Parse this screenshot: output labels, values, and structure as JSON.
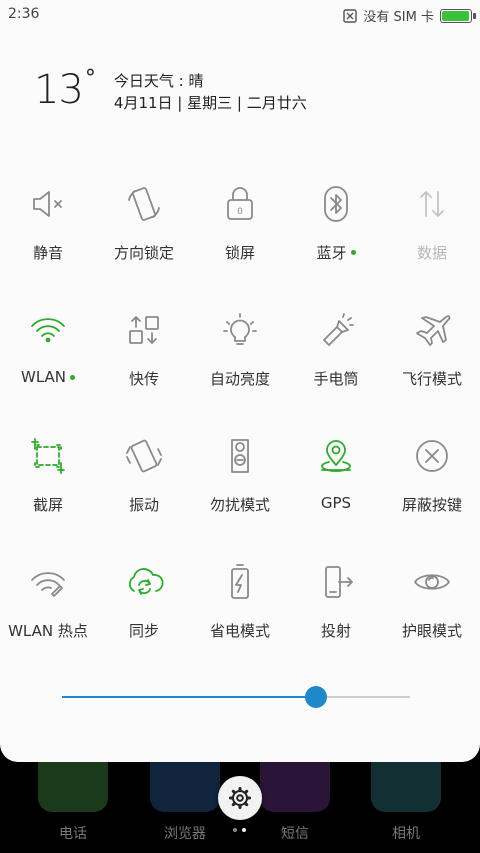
{
  "status": {
    "time": "2:36",
    "sim": "没有 SIM 卡",
    "battery_level": 0.95,
    "battery_color": "#3ec13a"
  },
  "weather": {
    "temp": "13",
    "degree": "°",
    "line1": "今日天气 : 晴",
    "line2": "4月11日 | 星期三 | 二月廿六"
  },
  "toggles": [
    {
      "label": "静音",
      "icon": "mute-icon",
      "active": false
    },
    {
      "label": "方向锁定",
      "icon": "rotation-lock-icon",
      "active": false
    },
    {
      "label": "锁屏",
      "icon": "lock-icon",
      "active": false
    },
    {
      "label": "蓝牙",
      "icon": "bluetooth-icon",
      "active": false,
      "dot": true
    },
    {
      "label": "数据",
      "icon": "data-icon",
      "active": false,
      "dim": true
    },
    {
      "label": "WLAN",
      "icon": "wifi-icon",
      "active": true,
      "dot": true
    },
    {
      "label": "快传",
      "icon": "transfer-icon",
      "active": false
    },
    {
      "label": "自动亮度",
      "icon": "brightness-icon",
      "active": false
    },
    {
      "label": "手电筒",
      "icon": "flashlight-icon",
      "active": false
    },
    {
      "label": "飞行模式",
      "icon": "airplane-icon",
      "active": false
    },
    {
      "label": "截屏",
      "icon": "screenshot-icon",
      "active": true
    },
    {
      "label": "振动",
      "icon": "vibrate-icon",
      "active": false
    },
    {
      "label": "勿扰模式",
      "icon": "dnd-icon",
      "active": false
    },
    {
      "label": "GPS",
      "icon": "gps-icon",
      "active": true
    },
    {
      "label": "屏蔽按键",
      "icon": "block-keys-icon",
      "active": false
    },
    {
      "label": "WLAN 热点",
      "icon": "hotspot-icon",
      "active": false
    },
    {
      "label": "同步",
      "icon": "sync-icon",
      "active": true
    },
    {
      "label": "省电模式",
      "icon": "battery-saver-icon",
      "active": false
    },
    {
      "label": "投射",
      "icon": "cast-icon",
      "active": false
    },
    {
      "label": "护眼模式",
      "icon": "eye-icon",
      "active": false
    }
  ],
  "brightness": {
    "level": 0.73,
    "accent": "#1e88c8"
  },
  "dock": {
    "apps": [
      "电话",
      "浏览器",
      "短信",
      "相机"
    ]
  },
  "colors": {
    "active": "#2eaa2e",
    "inactive": "#8a8a8a",
    "dim": "#c4c4c4"
  }
}
